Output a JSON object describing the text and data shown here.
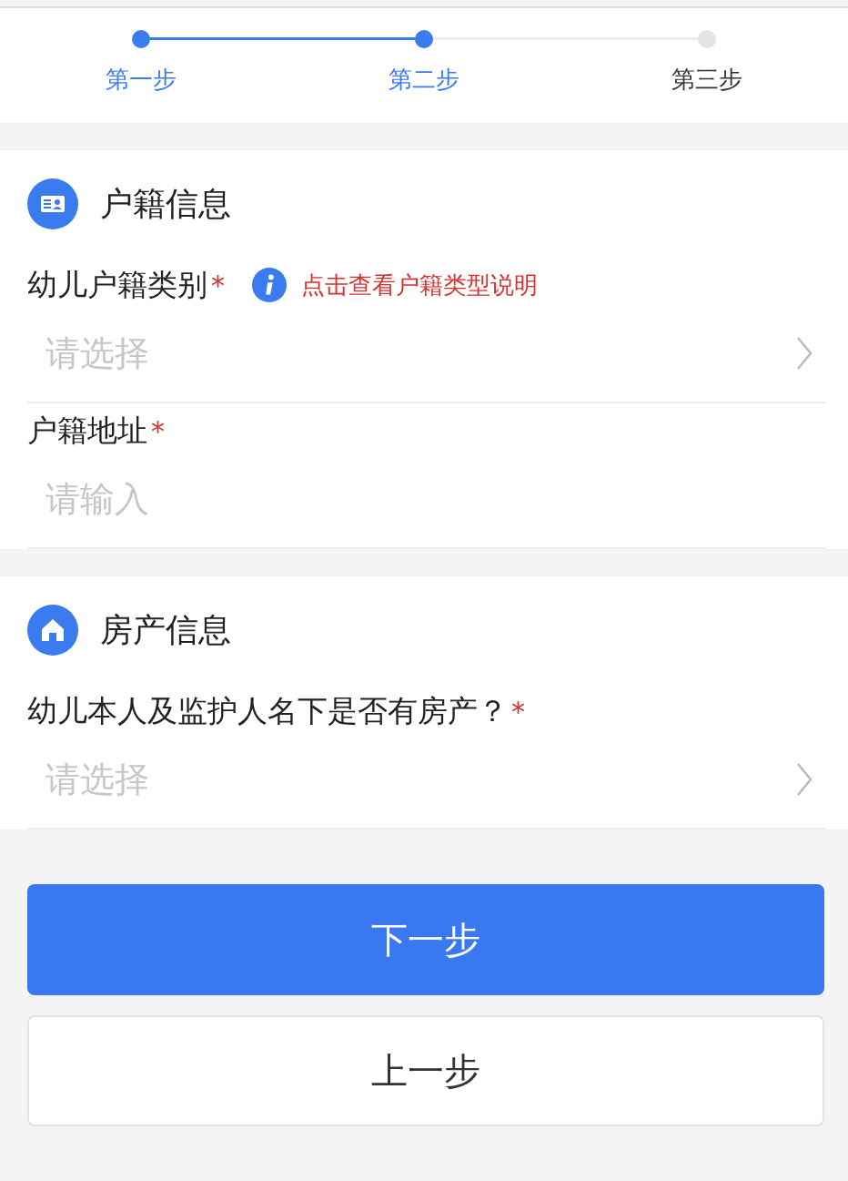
{
  "steps": [
    {
      "label": "第一步",
      "done": true
    },
    {
      "label": "第二步",
      "done": true
    },
    {
      "label": "第三步",
      "done": false
    }
  ],
  "sections": [
    {
      "title": "户籍信息",
      "fields": [
        {
          "label": "幼儿户籍类别",
          "required_mark": "*",
          "kind": "select",
          "placeholder": "请选择",
          "hint": "点击查看户籍类型说明"
        },
        {
          "label": "户籍地址",
          "required_mark": "*",
          "kind": "input",
          "placeholder": "请输入"
        }
      ]
    },
    {
      "title": "房产信息",
      "fields": [
        {
          "label": "幼儿本人及监护人名下是否有房产？",
          "required_mark": "*",
          "kind": "select",
          "placeholder": "请选择"
        }
      ]
    }
  ],
  "buttons": [
    {
      "label": "下一步",
      "kind": "primary"
    },
    {
      "label": "上一步",
      "kind": "secondary"
    }
  ]
}
